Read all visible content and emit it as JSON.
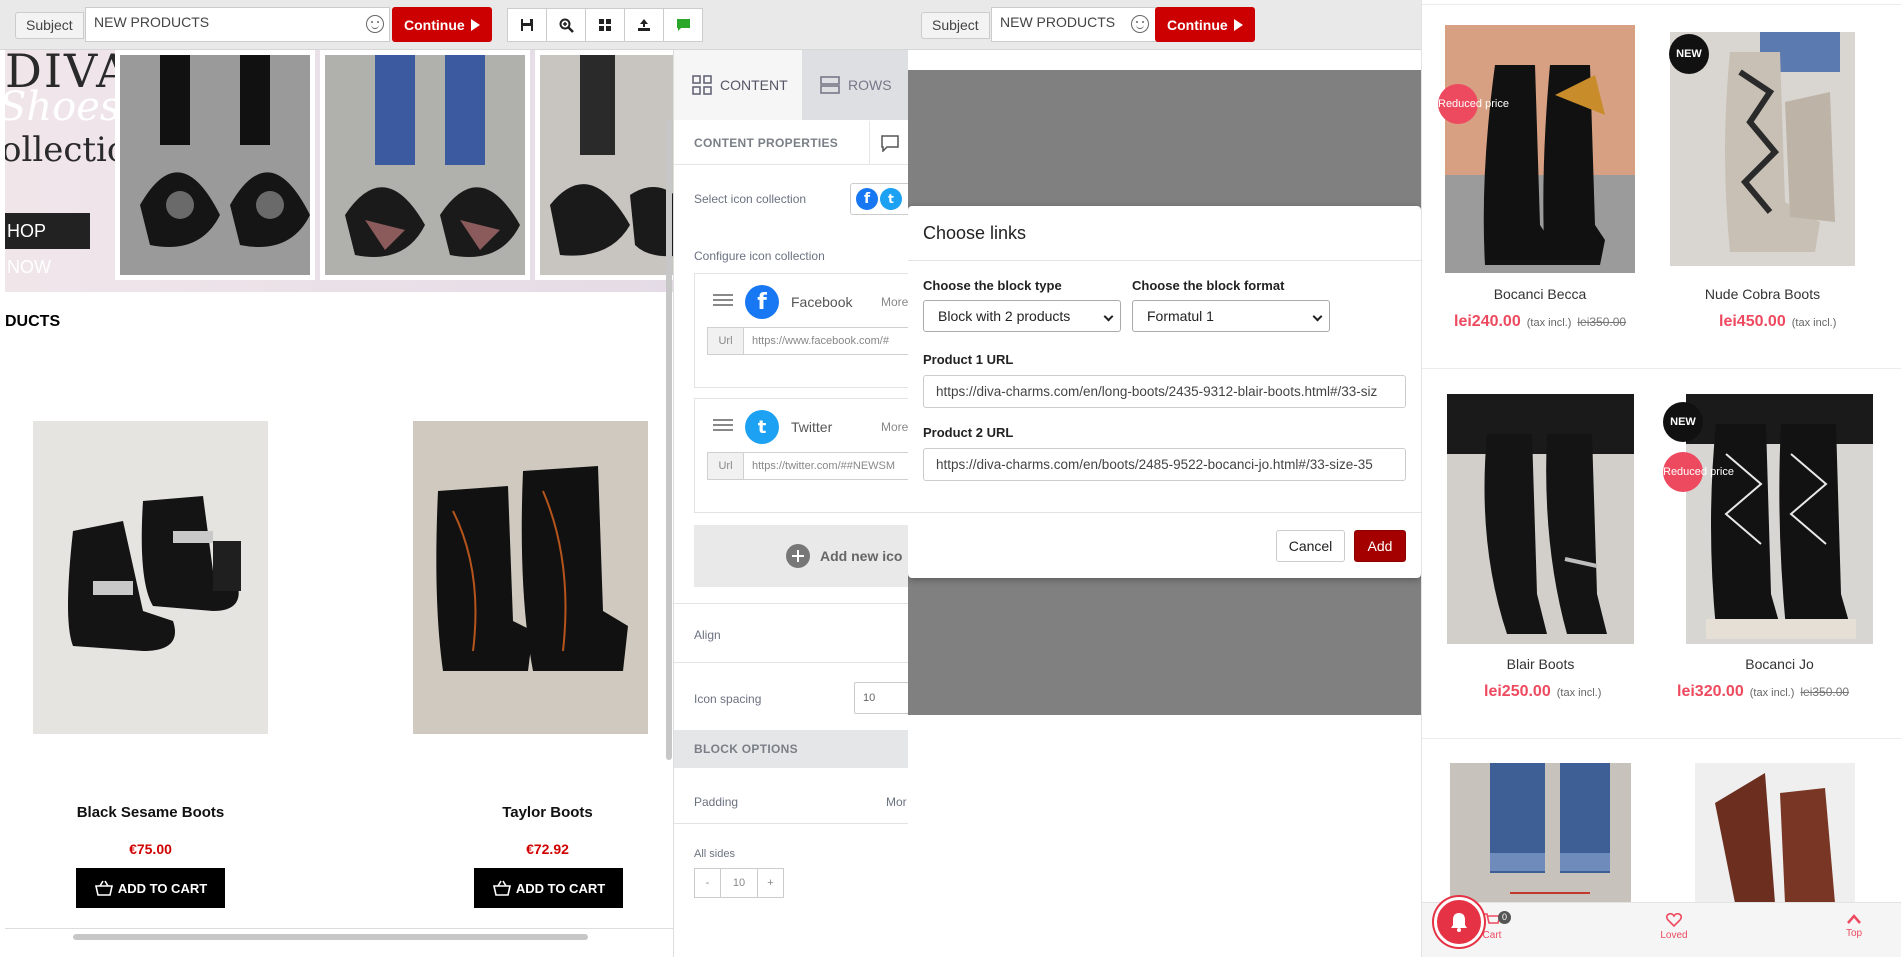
{
  "left_editor": {
    "subject_label": "Subject",
    "subject_value": "NEW PRODUCTS",
    "continue_label": "Continue",
    "hero": {
      "brand": "DIVA",
      "script_text": "Shoes",
      "collection_text": "ollection",
      "shop_now": "HOP NOW"
    },
    "section_title": "DUCTS",
    "products": [
      {
        "name": "Black Sesame Boots",
        "price": "€75.00",
        "cart_label": "ADD TO CART"
      },
      {
        "name": "Taylor Boots",
        "price": "€72.92",
        "cart_label": "ADD TO CART"
      }
    ],
    "sidebar": {
      "tab_content": "CONTENT",
      "tab_rows": "ROWS",
      "content_properties": "CONTENT PROPERTIES",
      "select_icon_collection": "Select icon collection",
      "configure_icon_collection": "Configure icon collection",
      "icons": [
        {
          "name": "Facebook",
          "more": "More o",
          "url_label": "Url",
          "url": "https://www.facebook.com/#"
        },
        {
          "name": "Twitter",
          "more": "More o",
          "url_label": "Url",
          "url": "https://twitter.com/##NEWSM"
        }
      ],
      "add_new_icon": "Add new ico",
      "align_label": "Align",
      "icon_spacing_label": "Icon spacing",
      "icon_spacing_value": "10",
      "block_options": "BLOCK OPTIONS",
      "padding_label": "Padding",
      "padding_more": "Mor",
      "all_sides_label": "All sides",
      "all_sides_value": "10",
      "minus": "-",
      "plus": "+"
    }
  },
  "middle": {
    "subject_label": "Subject",
    "subject_value": "NEW  PRODUCTS",
    "continue_label": "Continue",
    "modal": {
      "title": "Choose links",
      "block_type_label": "Choose the block type",
      "block_type_value": "Block with 2 products",
      "block_format_label": "Choose the block format",
      "block_format_value": "Formatul 1",
      "product1_label": "Product 1 URL",
      "product1_value": "https://diva-charms.com/en/long-boots/2435-9312-blair-boots.html#/33-siz",
      "product2_label": "Product 2 URL",
      "product2_value": "https://diva-charms.com/en/boots/2485-9522-bocanci-jo.html#/33-size-35",
      "cancel_label": "Cancel",
      "add_label": "Add"
    }
  },
  "shop": {
    "products": [
      {
        "name": "Bocanci Becca",
        "price": "lei240.00",
        "tax": "(tax incl.)",
        "old_price": "lei350.00",
        "badges": [
          "Reduced price"
        ]
      },
      {
        "name": "Nude Cobra Boots",
        "price": "lei450.00",
        "tax": "(tax incl.)",
        "old_price": "",
        "badges": [
          "NEW"
        ]
      },
      {
        "name": "Blair Boots",
        "price": "lei250.00",
        "tax": "(tax incl.)",
        "old_price": "",
        "badges": []
      },
      {
        "name": "Bocanci Jo",
        "price": "lei320.00",
        "tax": "(tax incl.)",
        "old_price": "lei350.00",
        "badges": [
          "NEW",
          "Reduced price"
        ]
      }
    ],
    "bottom_bar": {
      "cart_label": "Cart",
      "cart_count": "0",
      "loved_label": "Loved",
      "top_label": "Top"
    }
  },
  "colors": {
    "accent_red": "#cc0000",
    "shop_pink": "#ee4a5f",
    "facebook_blue": "#1877f2",
    "twitter_blue": "#1da1f2"
  }
}
